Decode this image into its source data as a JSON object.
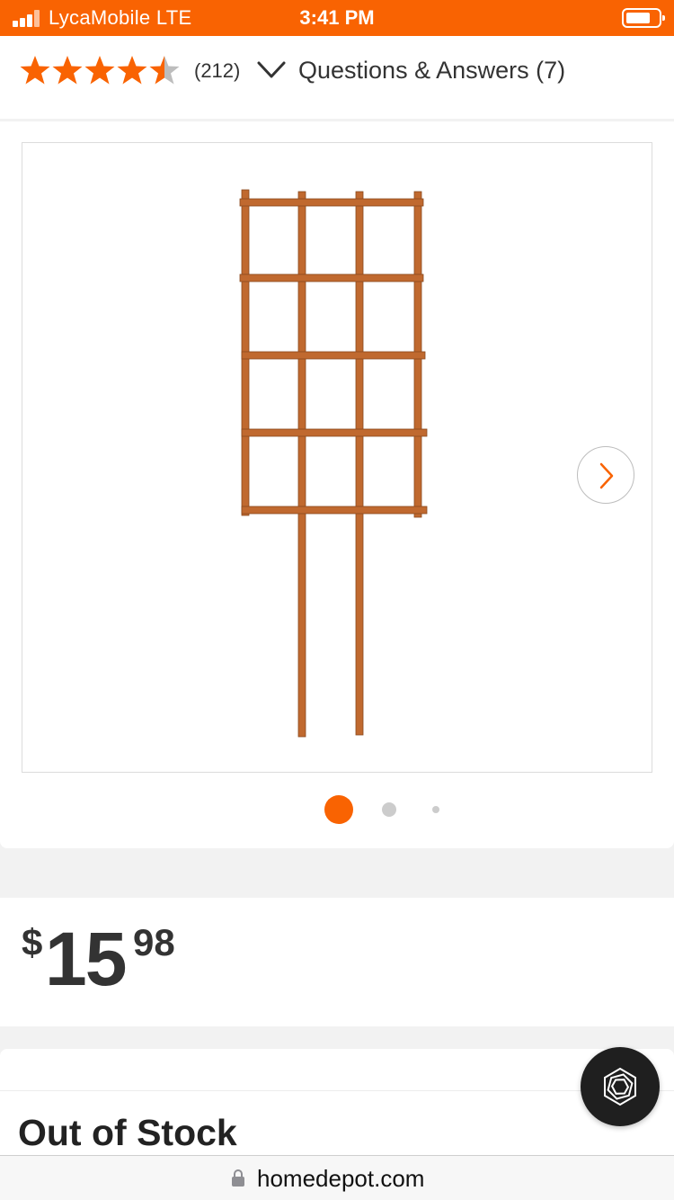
{
  "status_bar": {
    "carrier": "LycaMobile  LTE",
    "time": "3:41 PM",
    "background_color": "#f96302"
  },
  "rating": {
    "stars": 4.5,
    "count_text": "(212)",
    "qa_label": "Questions & Answers (7)",
    "star_color": "#f96302"
  },
  "gallery": {
    "total_images": 3,
    "active_index": 0,
    "next_icon": "chevron-right-icon"
  },
  "price": {
    "currency": "$",
    "dollars": "15",
    "cents": "98"
  },
  "stock": {
    "title": "Out of Stock"
  },
  "browser": {
    "url": "homedepot.com"
  },
  "colors": {
    "accent": "#f96302",
    "trellis_wood": "#c0692f",
    "text": "#333333"
  }
}
